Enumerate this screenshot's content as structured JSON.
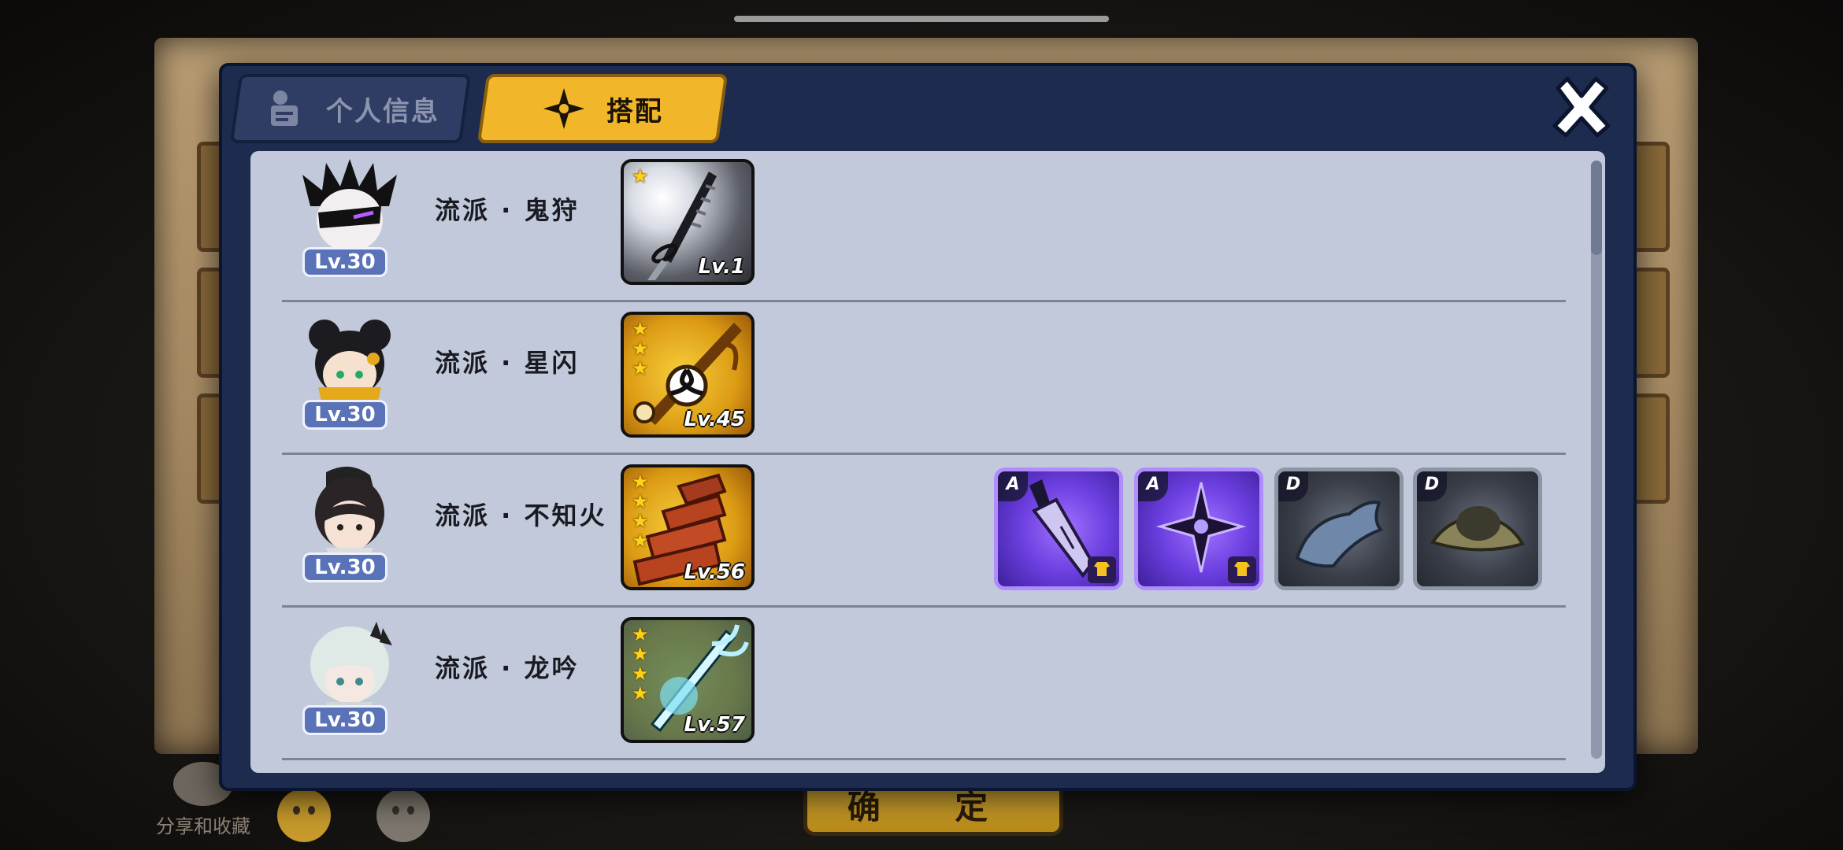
{
  "dialog": {
    "tabs": [
      {
        "label": "个人信息",
        "icon": "profile-card-icon",
        "active": false
      },
      {
        "label": "搭配",
        "icon": "shuriken-icon",
        "active": true
      }
    ],
    "close_icon": "close-icon"
  },
  "loadouts": [
    {
      "level": "Lv.30",
      "school": "流派 · 鬼狩",
      "weapon": {
        "stars": 1,
        "level": "Lv.1",
        "tone": "grey"
      },
      "equipment": []
    },
    {
      "level": "Lv.30",
      "school": "流派 · 星闪",
      "weapon": {
        "stars": 3,
        "level": "Lv.45",
        "tone": "gold"
      },
      "equipment": []
    },
    {
      "level": "Lv.30",
      "school": "流派 · 不知火",
      "weapon": {
        "stars": 4,
        "level": "Lv.56",
        "tone": "gold"
      },
      "equipment": [
        {
          "grade": "A",
          "tone": "purple",
          "icon": "dagger-icon",
          "bonus": true
        },
        {
          "grade": "A",
          "tone": "purple",
          "icon": "dark-shuriken-icon",
          "bonus": true
        },
        {
          "grade": "D",
          "tone": "dark",
          "icon": "cloth-icon",
          "bonus": false
        },
        {
          "grade": "D",
          "tone": "dark",
          "icon": "straw-hat-icon",
          "bonus": false
        }
      ]
    },
    {
      "level": "Lv.30",
      "school": "流派 · 龙吟",
      "weapon": {
        "stars": 4,
        "level": "Lv.57",
        "tone": "gold"
      },
      "equipment": []
    }
  ],
  "background": {
    "confirm_label": "确 定",
    "share_label": "分享和收藏"
  },
  "colors": {
    "dialog_bg": "#1d2b4f",
    "panel_bg": "#c1c9da",
    "active_tab": "#f2b62a",
    "level_badge": "#5a72b8",
    "star": "#ffd21a",
    "rare_purple": "#6c3fe0"
  }
}
